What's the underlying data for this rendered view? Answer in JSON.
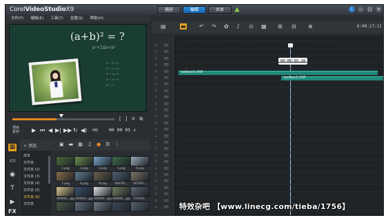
{
  "app": {
    "brand_prefix": "Corel",
    "brand_name": "VideoStudio",
    "brand_version": "X9",
    "colors": {
      "accent_tab": "#1f7bd1",
      "clip": "#1f8a7a",
      "selected_icon": "#e6a321",
      "scrub_fill": "#e08a1c"
    }
  },
  "tabs": [
    {
      "label": "捕获",
      "active": false
    },
    {
      "label": "编辑",
      "active": true
    },
    {
      "label": "共享",
      "active": false
    }
  ],
  "window_buttons": [
    "i",
    "—",
    "□",
    "✕"
  ],
  "menu": [
    "文件(F)",
    "编辑(E)",
    "工具(T)",
    "设置(S)",
    "帮助(H)"
  ],
  "preview": {
    "formula": "(a+b)² = ?",
    "formula_sub": "a²+2ab+b²",
    "chalk_lines": [
      "2² = 2 × 2",
      "2² = 4 + 4",
      "3² = 3 × 3",
      "3² = 9 + 9",
      "b² = ?"
    ]
  },
  "player": {
    "mode_labels": [
      "项目",
      "素材"
    ],
    "progress": 0.43,
    "marker_icons": [
      "[",
      "]",
      "✕",
      "⧉"
    ],
    "controls": [
      "▶",
      "⏮",
      "◀",
      "▶|",
      "▶▶",
      "↻",
      "◀)",
      "HD"
    ],
    "timecode": "00 00 05 ⇕"
  },
  "library": {
    "add_label": "+ 添加",
    "tool_icons": [
      "▣",
      "▬",
      "▦",
      "♫",
      "●",
      "☰",
      "⋮"
    ],
    "side_icons": [
      "▦",
      "▭",
      "◉",
      "T",
      "▶",
      "FX"
    ],
    "folders": [
      "样本",
      "文件夹",
      "文件夹 (2)",
      "文件夹 (3)",
      "文件夹 (4)",
      "文件夹 (5)",
      "文件夹 (6)",
      "文件夹"
    ],
    "selected_folder": 6,
    "thumbs": [
      [
        "1.png",
        "2.png",
        "3.png",
        "5.png",
        "6.png"
      ],
      [
        "7.png",
        "8.png",
        "9.png",
        "004765...",
        "007067..."
      ],
      [
        "000001...jpg",
        "000003...jpg",
        "000002...jpg",
        "000001...jpg",
        "T21010..."
      ],
      [
        "",
        "",
        "",
        "",
        ""
      ]
    ]
  },
  "timeline": {
    "tool_icons": [
      "▤",
      "▬",
      "↶",
      "↷",
      "✿",
      "♪",
      "⊙",
      "▦",
      "⊞",
      "⊟",
      "⊕"
    ],
    "zoom_readout": "0:00:17:21",
    "playhead_time": "00:00:05.28",
    "clips": [
      {
        "name": "beiban1.VSP",
        "track": 0,
        "start": 0.0,
        "end": 0.97
      },
      {
        "name": "beiban2.VSP",
        "track": 1,
        "start": 0.5,
        "end": 1.0
      }
    ]
  },
  "watermark": "特效杂吧 【www.linecg.com/tieba/1756】"
}
